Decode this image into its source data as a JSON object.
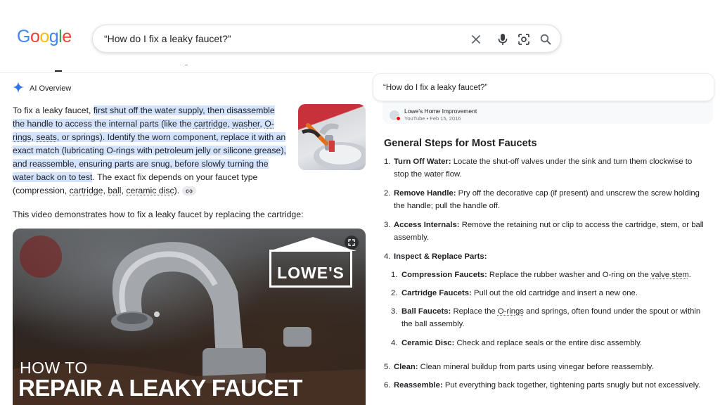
{
  "logo": {
    "letters": [
      "G",
      "o",
      "o",
      "g",
      "l",
      "e"
    ],
    "colors": [
      "#4285F4",
      "#EA4335",
      "#FBBC05",
      "#4285F4",
      "#34A853",
      "#EA4335"
    ]
  },
  "search": {
    "query": "“How do I fix a leaky faucet?”",
    "icons": [
      "close-icon",
      "mic-icon",
      "lens-icon",
      "search-icon"
    ]
  },
  "ai_overview": {
    "label": "AI Overview",
    "p1_lead": "To fix a leaky faucet, ",
    "p1_hl1": "first shut off the water supply, then disassemble the handle to access the internal parts (like the ",
    "p1_cartridge": "cartridge",
    "p1_c1": ", ",
    "p1_washer": "washer",
    "p1_c2": ", ",
    "p1_orings": "O-rings",
    "p1_c3": ", ",
    "p1_seats": "seats",
    "p1_hl2": ", or springs). Identify the worn component, replace it with an exact match (lubricating O-rings with petroleum jelly or silicone grease), and reassemble, ensuring parts are snug, before slowly turning the water back on to test",
    "p1_tail1": ". The exact fix depends on your faucet type (compression, ",
    "p1_cartridge2": "cartridge",
    "p1_c4": ", ",
    "p1_ball": "ball",
    "p1_c5": ", ",
    "p1_ceramic": "ceramic disc",
    "p1_tail2": ").",
    "p2": "This video demonstrates how to fix a leaky faucet by replacing the cartridge:",
    "video": {
      "brand": "LOWE'S",
      "title_line1": "HOW TO",
      "title_line2": "REPAIR A LEAKY FAUCET"
    }
  },
  "right_panel": {
    "query": "“How do I fix a leaky faucet?”",
    "source": {
      "name": "Lowe's Home Improvement",
      "meta": "YouTube • Feb 15, 2016"
    },
    "heading": "General Steps for Most Faucets",
    "steps": [
      {
        "num": "1.",
        "title": "Turn Off Water:",
        "text": " Locate the shut-off valves under the sink and turn them clockwise to stop the water flow."
      },
      {
        "num": "2.",
        "title": "Remove Handle:",
        "text": " Pry off the decorative cap (if present) and unscrew the screw holding the handle; pull the handle off."
      },
      {
        "num": "3.",
        "title": "Access Internals:",
        "text": " Remove the retaining nut or clip to access the cartridge, stem, or ball assembly."
      },
      {
        "num": "4.",
        "title": "Inspect & Replace Parts:",
        "text": ""
      },
      {
        "num": "5.",
        "title": "Clean:",
        "text": " Clean mineral buildup from parts using vinegar before reassembly."
      },
      {
        "num": "6.",
        "title": "Reassemble:",
        "text": " Put everything back together, tightening parts snugly but not excessively."
      }
    ],
    "substeps": [
      {
        "num": "1.",
        "title": "Compression Faucets:",
        "text_a": " Replace the rubber washer and O-ring on the ",
        "text_ul": "valve stem",
        "text_b": "."
      },
      {
        "num": "2.",
        "title": "Cartridge Faucets:",
        "text_a": " Pull out the old cartridge and insert a new one.",
        "text_ul": "",
        "text_b": ""
      },
      {
        "num": "3.",
        "title": "Ball Faucets:",
        "text_a": " Replace the ",
        "text_ul": "O-rings",
        "text_b": " and springs, often found under the spout or within the ball assembly."
      },
      {
        "num": "4.",
        "title": "Ceramic Disc:",
        "text_a": " Check and replace seals or the entire disc assembly.",
        "text_ul": "",
        "text_b": ""
      }
    ]
  }
}
